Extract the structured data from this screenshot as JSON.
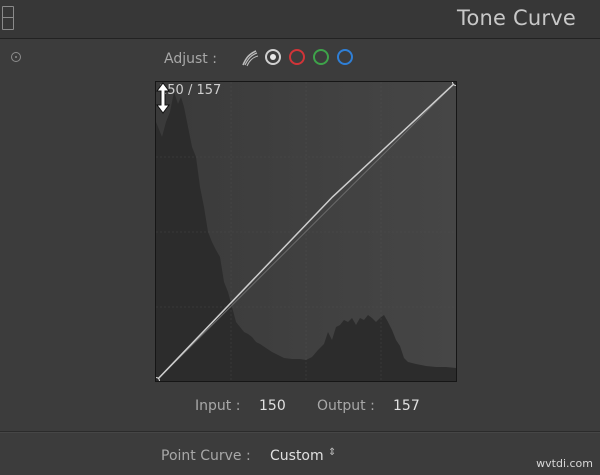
{
  "header": {
    "title": "Tone Curve",
    "panel_toggle_icon": "panel-collapse-icon"
  },
  "toolbar": {
    "adjust_label": "Adjust :",
    "channels": [
      {
        "name": "point-curve",
        "icon": "point-curve-icon"
      },
      {
        "name": "rgb",
        "icon": "rgb-channel-icon",
        "color": "#d0d0d0",
        "selected": true
      },
      {
        "name": "red",
        "icon": "red-channel-icon",
        "color": "#d13438"
      },
      {
        "name": "green",
        "icon": "green-channel-icon",
        "color": "#3ea34a"
      },
      {
        "name": "blue",
        "icon": "blue-channel-icon",
        "color": "#2f7fd6"
      }
    ]
  },
  "graph": {
    "readout": "150 / 157",
    "curve_points": [
      {
        "input": 0,
        "output": 0
      },
      {
        "input": 150,
        "output": 157
      },
      {
        "input": 255,
        "output": 255
      }
    ],
    "cursor_icon": "vertical-resize-icon"
  },
  "io": {
    "input_label": "Input :",
    "input_value": "150",
    "output_label": "Output :",
    "output_value": "157"
  },
  "point_curve": {
    "label": "Point Curve :",
    "value": "Custom",
    "caret": "⇕"
  },
  "watermark": "wvtdi.com"
}
